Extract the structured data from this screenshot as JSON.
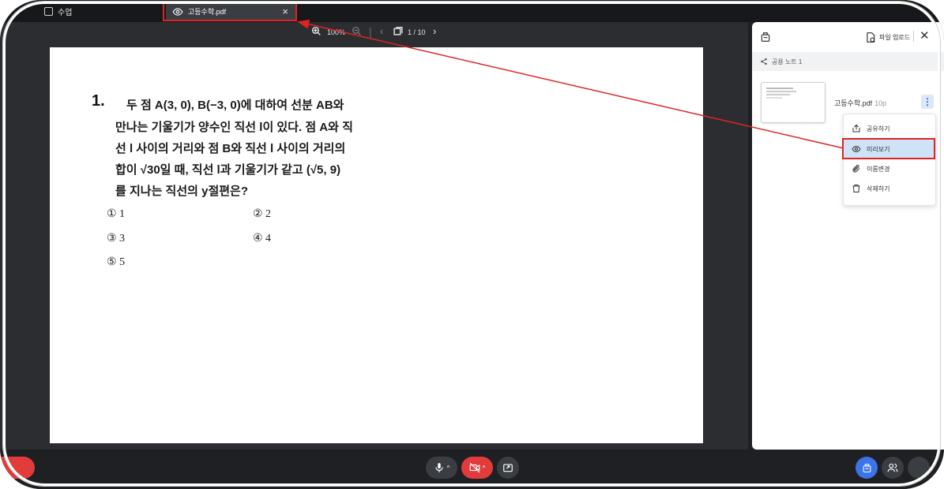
{
  "app": {
    "title": "수업"
  },
  "tab": {
    "label": "고등수학.pdf",
    "close": "×"
  },
  "toolbar": {
    "zoom": "100%",
    "page": "1 / 10"
  },
  "question": {
    "number": "1.",
    "lines": [
      "두 점 A(3, 0), B(−3, 0)에 대하여 선분 AB와",
      "만나는 기울기가 양수인 직선 l이 있다. 점 A와 직",
      "선 l 사이의 거리와 점 B와 직선 l 사이의 거리의",
      "합이 √30일 때, 직선 l과 기울기가 같고 (√5, 9)",
      "를 지나는 직선의 y절편은?"
    ],
    "choices": [
      "① 1",
      "② 2",
      "③ 3",
      "④ 4",
      "⑤ 5"
    ]
  },
  "panel": {
    "upload_label": "파일 업로드",
    "shared_label": "공용 노트 1",
    "file_name": "고등수학.pdf",
    "file_pages": "10p",
    "menu": {
      "share": "공유하기",
      "preview": "미리보기",
      "rename": "이름변경",
      "delete": "삭제하기"
    }
  },
  "colors": {
    "highlight": "#e02424",
    "accent": "#3b73e8",
    "camera_off": "#e23b3b"
  },
  "icons": [
    "eye-icon",
    "zoom-in-icon",
    "zoom-out-icon",
    "page-icon",
    "mic-icon",
    "camera-off-icon",
    "share-screen-icon",
    "participants-icon",
    "lock-icon"
  ]
}
